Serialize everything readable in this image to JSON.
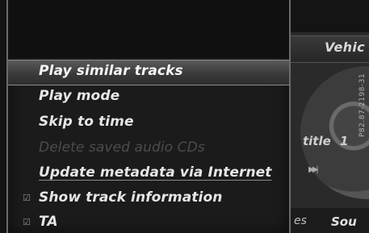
{
  "background": {
    "header_title": "Vehic",
    "track_label": "title",
    "track_number": "1",
    "skip_icon": "skip-forward-icon",
    "bottom_left": "es",
    "bottom_right": "Sou",
    "image_code": "P82.87-2198-31"
  },
  "menu": {
    "items": [
      {
        "label": "Play similar tracks",
        "state": "selected"
      },
      {
        "label": "Play mode",
        "state": "normal"
      },
      {
        "label": "Skip to time",
        "state": "normal"
      },
      {
        "label": "Delete saved audio CDs",
        "state": "disabled"
      },
      {
        "label": "Update metadata via Internet",
        "state": "normal"
      },
      {
        "label": "Show track information",
        "state": "checked"
      },
      {
        "label": "TA",
        "state": "checked"
      }
    ]
  },
  "colors": {
    "background": "#141414",
    "menu_bg": "#1b1b1b",
    "selected_bg": "#4a4a4a",
    "text": "#e6e6e6",
    "disabled_text": "#4c4c4c"
  }
}
